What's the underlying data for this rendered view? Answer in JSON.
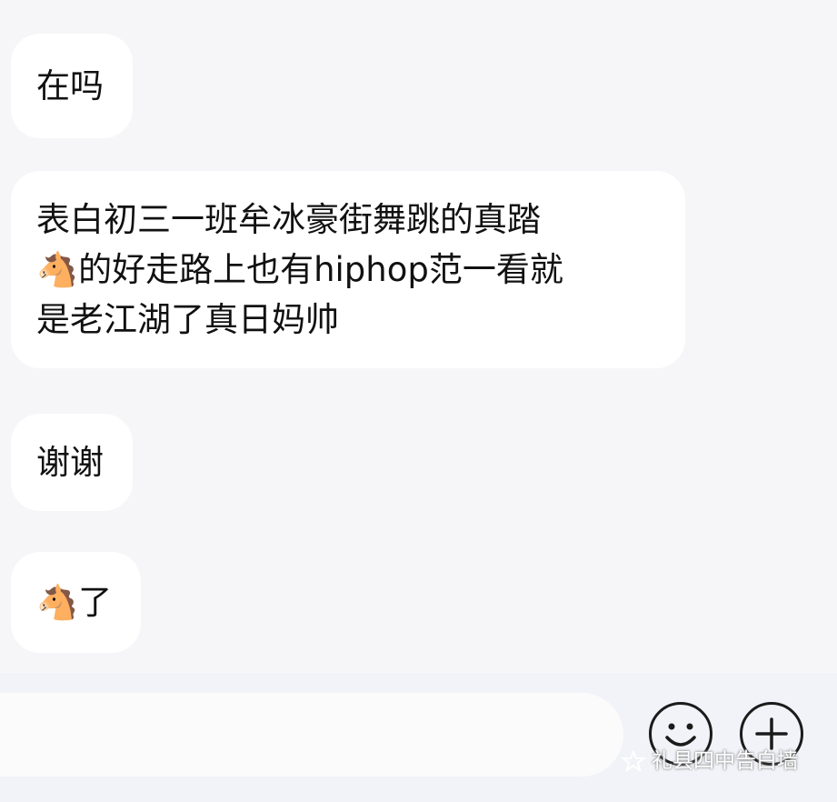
{
  "messages": [
    {
      "text": "在吗"
    },
    {
      "lines": [
        "表白初三一班牟冰豪街舞跳的真踏",
        "🐴的好走路上也有hiphop范一看就",
        "是老江湖了真日妈帅"
      ]
    },
    {
      "text": "谢谢"
    },
    {
      "text": "🐴了"
    }
  ],
  "toolbar": {
    "emoji_icon": "smiley-face-icon",
    "plus_icon": "plus-icon"
  },
  "watermark": {
    "text": "礼县四中告白墙"
  },
  "colors": {
    "background": "#f6f6f8",
    "bubble": "#ffffff",
    "text": "#111111"
  }
}
